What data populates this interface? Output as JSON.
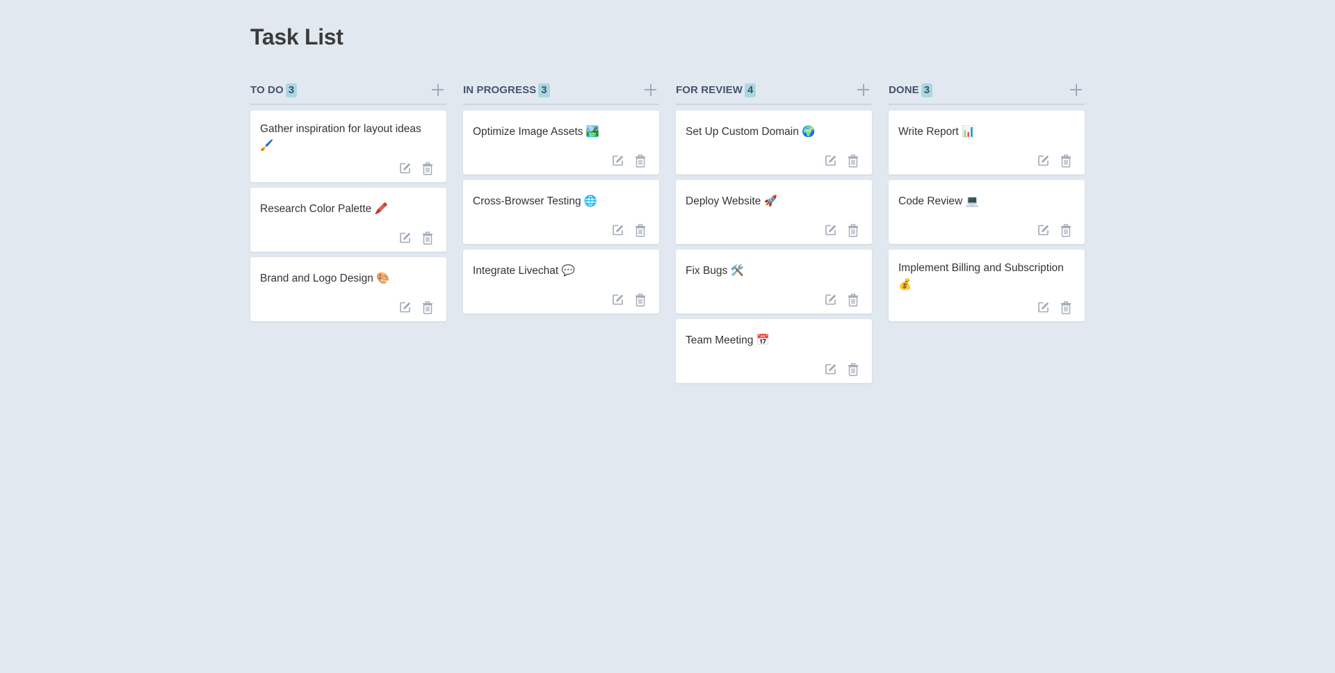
{
  "page": {
    "title": "Task List"
  },
  "colors": {
    "background": "#e1e8f0",
    "badge": "#a9d7e2",
    "card": "#ffffff",
    "icon": "#a0a9b6"
  },
  "icons": {
    "add": "plus-icon",
    "edit": "edit-icon",
    "delete": "trash-icon"
  },
  "columns": [
    {
      "title": "TO DO",
      "count": "3",
      "cards": [
        {
          "title": "Gather inspiration for layout ideas 🖌️"
        },
        {
          "title": "Research Color Palette 🖍️"
        },
        {
          "title": "Brand and Logo Design 🎨"
        }
      ]
    },
    {
      "title": "IN PROGRESS",
      "count": "3",
      "cards": [
        {
          "title": "Optimize Image Assets 🏞️"
        },
        {
          "title": "Cross-Browser Testing 🌐"
        },
        {
          "title": "Integrate Livechat 💬"
        }
      ]
    },
    {
      "title": "FOR REVIEW",
      "count": "4",
      "cards": [
        {
          "title": "Set Up Custom Domain 🌍"
        },
        {
          "title": "Deploy Website 🚀"
        },
        {
          "title": "Fix Bugs 🛠️"
        },
        {
          "title": "Team Meeting 📅"
        }
      ]
    },
    {
      "title": "DONE",
      "count": "3",
      "cards": [
        {
          "title": "Write Report 📊"
        },
        {
          "title": "Code Review 💻"
        },
        {
          "title": "Implement Billing and Subscription 💰"
        }
      ]
    }
  ]
}
